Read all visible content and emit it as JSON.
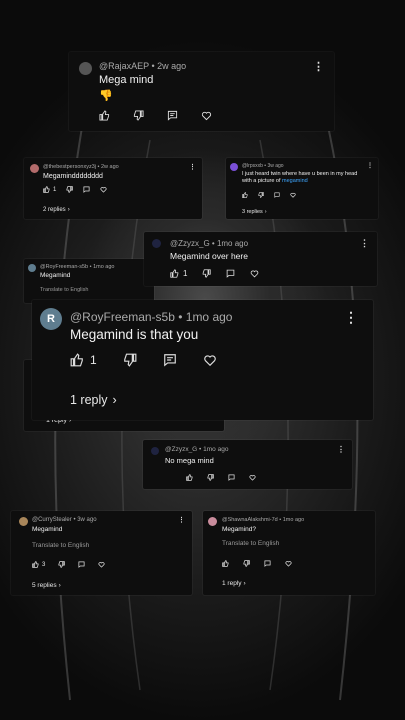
{
  "cards": {
    "c1": {
      "author": "@RajaxAEP",
      "time": "2w ago",
      "text": "Mega mind",
      "emoji": "👎"
    },
    "c2": {
      "author": "@thebestpersonxyz3j",
      "time": "2w ago",
      "text": "Megamindddddddd",
      "likes": "1",
      "replies": "2 replies"
    },
    "c3": {
      "author": "@lrpsxxb",
      "time": "3w ago",
      "text_pre": "I just heard twin where have u been in my head with a picture of ",
      "text_link": "megamind",
      "replies": "3 replies"
    },
    "c4": {
      "author": "@Zzyzx_G",
      "time": "1mo ago",
      "text": "Megamind over here",
      "likes": "1"
    },
    "c5": {
      "author": "@RoyFreeman-s5b",
      "time": "1mo ago",
      "text": "Megamind",
      "translate": "Translate to English"
    },
    "c6": {
      "avatar": "R",
      "author": "@RoyFreeman-s5b",
      "time": "1mo ago",
      "text": "Megamind is that you",
      "likes": "1",
      "replies": "1 reply"
    },
    "c6b": {
      "replies": "1 reply"
    },
    "c7": {
      "author": "@Zzyzx_G",
      "time": "1mo ago",
      "text": "No mega mind"
    },
    "c8": {
      "author": "@CurryStealer",
      "time": "3w ago",
      "text": "Megamind",
      "translate": "Translate to English",
      "likes": "3",
      "replies": "5 replies"
    },
    "c9": {
      "author": "@ShawnaAlakshmi-7d",
      "time": "1mo ago",
      "text": "Megamind?",
      "translate": "Translate to English",
      "replies": "1 reply"
    }
  },
  "colors": {
    "card_bg": "#0e0e0e",
    "link": "#3ea6ff",
    "avatar_r": "#5f7d8f",
    "avatar_purple": "#7a4fd6"
  },
  "icons": [
    "thumbs-up-icon",
    "thumbs-down-icon",
    "reply-icon",
    "heart-icon",
    "more-vert-icon",
    "chevron-right-icon"
  ]
}
